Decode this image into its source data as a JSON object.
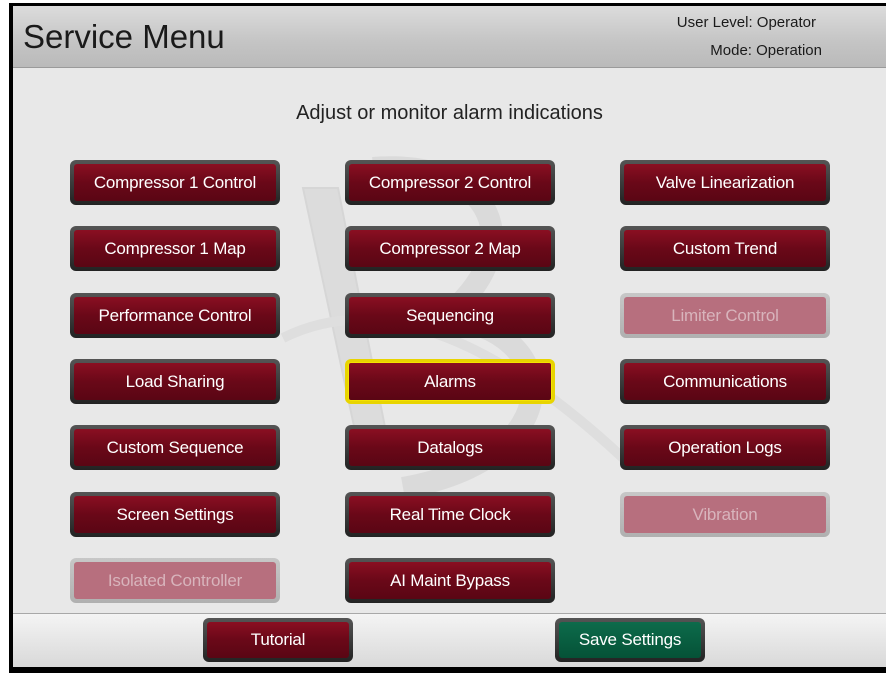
{
  "header": {
    "title": "Service Menu",
    "user_level": "User Level: Operator",
    "mode": "Mode: Operation"
  },
  "subtitle": "Adjust or monitor alarm indications",
  "menu": [
    {
      "label": "Compressor 1 Control",
      "state": "enabled"
    },
    {
      "label": "Compressor 2 Control",
      "state": "enabled"
    },
    {
      "label": "Valve Linearization",
      "state": "enabled"
    },
    {
      "label": "Compressor 1 Map",
      "state": "enabled"
    },
    {
      "label": "Compressor 2 Map",
      "state": "enabled"
    },
    {
      "label": "Custom Trend",
      "state": "enabled"
    },
    {
      "label": "Performance Control",
      "state": "enabled"
    },
    {
      "label": "Sequencing",
      "state": "enabled"
    },
    {
      "label": "Limiter Control",
      "state": "disabled"
    },
    {
      "label": "Load Sharing",
      "state": "enabled"
    },
    {
      "label": "Alarms",
      "state": "selected"
    },
    {
      "label": "Communications",
      "state": "enabled"
    },
    {
      "label": "Custom Sequence",
      "state": "enabled"
    },
    {
      "label": "Datalogs",
      "state": "enabled"
    },
    {
      "label": "Operation Logs",
      "state": "enabled"
    },
    {
      "label": "Screen Settings",
      "state": "enabled"
    },
    {
      "label": "Real Time Clock",
      "state": "enabled"
    },
    {
      "label": "Vibration",
      "state": "disabled"
    },
    {
      "label": "Isolated Controller",
      "state": "disabled"
    },
    {
      "label": "AI Maint Bypass",
      "state": "enabled"
    }
  ],
  "footer": {
    "tutorial_label": "Tutorial",
    "save_label": "Save Settings"
  },
  "colors": {
    "button_red": "#6a0818",
    "button_green": "#055237",
    "selected_border": "#e8d400"
  }
}
